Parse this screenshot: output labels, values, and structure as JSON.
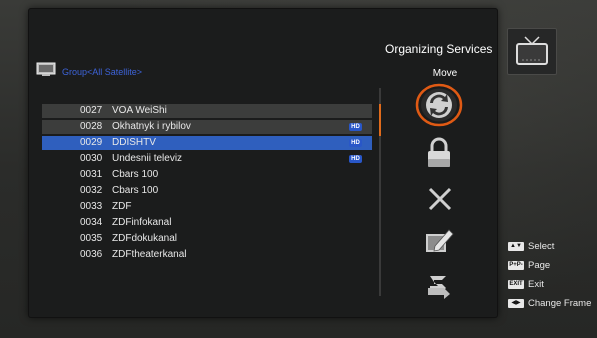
{
  "header": {
    "title": "Organizing Services",
    "mode_label": "Move"
  },
  "group": {
    "label": "Group<All Satellite>"
  },
  "channels": [
    {
      "num": "0027",
      "name": "VOA WeiShi",
      "hd": false,
      "style": "alt"
    },
    {
      "num": "0028",
      "name": "Okhatnyk i rybilov",
      "hd": true,
      "style": "alt"
    },
    {
      "num": "0029",
      "name": "DDISHTV",
      "hd": true,
      "style": "sel"
    },
    {
      "num": "0030",
      "name": "Undesnii televiz",
      "hd": true,
      "style": ""
    },
    {
      "num": "0031",
      "name": "Cbars 100",
      "hd": false,
      "style": ""
    },
    {
      "num": "0032",
      "name": "Cbars 100",
      "hd": false,
      "style": ""
    },
    {
      "num": "0033",
      "name": "ZDF",
      "hd": false,
      "style": ""
    },
    {
      "num": "0034",
      "name": "ZDFinfokanal",
      "hd": false,
      "style": ""
    },
    {
      "num": "0035",
      "name": "ZDFdokukanal",
      "hd": false,
      "style": ""
    },
    {
      "num": "0036",
      "name": "ZDFtheaterkanal",
      "hd": false,
      "style": ""
    }
  ],
  "hd_badge": "HD",
  "actions": [
    {
      "name": "move-action-icon",
      "active": true
    },
    {
      "name": "lock-icon",
      "active": false
    },
    {
      "name": "delete-icon",
      "active": false
    },
    {
      "name": "rename-icon",
      "active": false
    },
    {
      "name": "skip-icon",
      "active": false
    }
  ],
  "legend": {
    "select_key": "▲▼",
    "select": "Select",
    "page_key": "P+P-",
    "page": "Page",
    "exit_key": "EXIT",
    "exit": "Exit",
    "frame_key": "◀▶",
    "frame": "Change Frame"
  },
  "colors": {
    "selection": "#2f5fbe",
    "accent": "#e06b1c",
    "group_text": "#3d63d8"
  }
}
